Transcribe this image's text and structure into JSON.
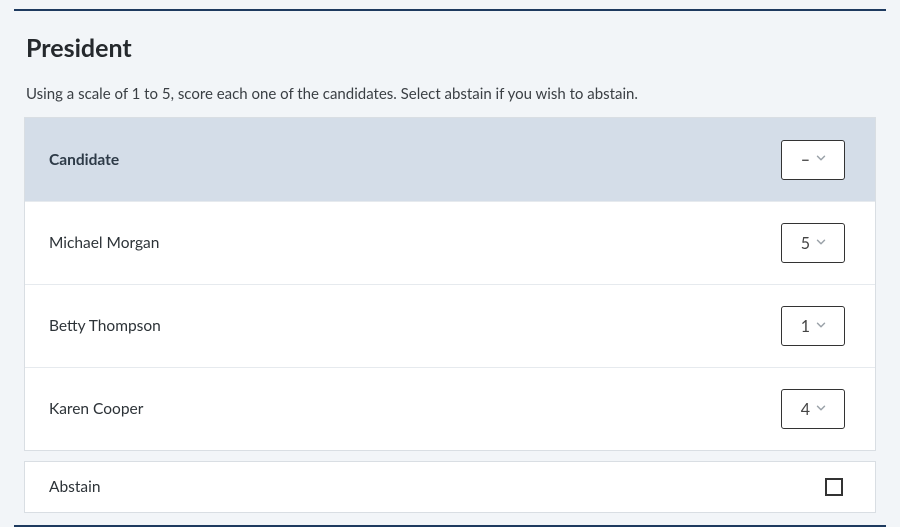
{
  "title": "President",
  "instructions": "Using a scale of 1 to 5, score each one of the candidates. Select abstain if you wish to abstain.",
  "header": {
    "label": "Candidate",
    "select_value": "–"
  },
  "candidates": [
    {
      "name": "Michael Morgan",
      "score": "5"
    },
    {
      "name": "Betty Thompson",
      "score": "1"
    },
    {
      "name": "Karen Cooper",
      "score": "4"
    }
  ],
  "abstain": {
    "label": "Abstain",
    "checked": false
  }
}
